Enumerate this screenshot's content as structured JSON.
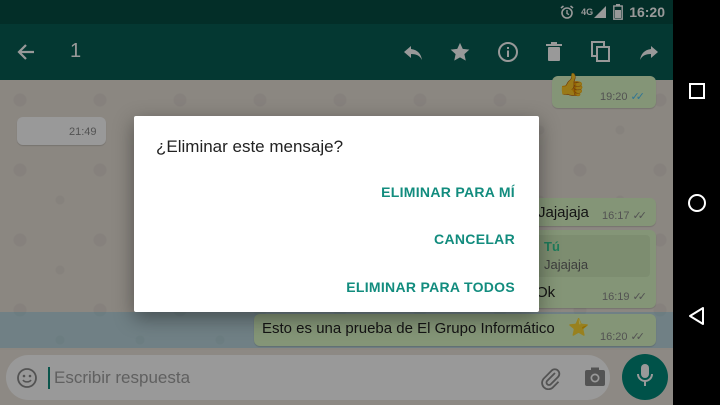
{
  "status_bar": {
    "time": "16:20",
    "network": "4G"
  },
  "toolbar": {
    "selected_count": "1"
  },
  "messages": [
    {
      "id": "thumb",
      "time": "19:20",
      "emoji": "👍"
    },
    {
      "id": "in1",
      "time": "21:49"
    },
    {
      "id": "jaja",
      "text": "Jajajaja",
      "time": "16:17"
    },
    {
      "id": "reply",
      "quote_author": "Tú",
      "quote_text": "Jajajaja",
      "text": "Ok",
      "time": "16:19"
    },
    {
      "id": "prueba",
      "text": "Esto es una prueba de El Grupo Informático",
      "emoji": "⭐",
      "time": "16:20"
    }
  ],
  "dialog": {
    "title": "¿Eliminar este mensaje?",
    "delete_for_me": "ELIMINAR PARA MÍ",
    "cancel": "CANCELAR",
    "delete_for_all": "ELIMINAR PARA TODOS"
  },
  "input": {
    "placeholder": "Escribir respuesta"
  },
  "colors": {
    "primary": "#075e54",
    "accent": "#128c7e",
    "outgoing_bubble": "#dcf8c6",
    "mic": "#00897b"
  }
}
